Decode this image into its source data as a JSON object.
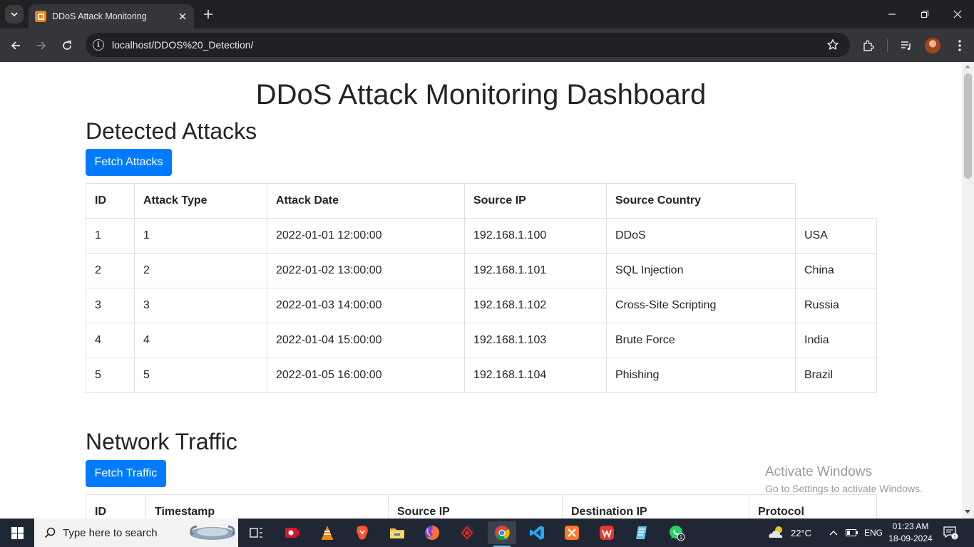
{
  "browser": {
    "tab_title": "DDoS Attack Monitoring",
    "url": "localhost/DDOS%20_Detection/"
  },
  "page": {
    "title": "DDoS Attack Monitoring Dashboard",
    "attacks": {
      "heading": "Detected Attacks",
      "button": "Fetch Attacks",
      "headers": [
        "ID",
        "Attack Type",
        "Attack Date",
        "Source IP",
        "Source Country"
      ],
      "rows": [
        [
          "1",
          "1",
          "2022-01-01 12:00:00",
          "192.168.1.100",
          "DDoS",
          "USA"
        ],
        [
          "2",
          "2",
          "2022-01-02 13:00:00",
          "192.168.1.101",
          "SQL Injection",
          "China"
        ],
        [
          "3",
          "3",
          "2022-01-03 14:00:00",
          "192.168.1.102",
          "Cross-Site Scripting",
          "Russia"
        ],
        [
          "4",
          "4",
          "2022-01-04 15:00:00",
          "192.168.1.103",
          "Brute Force",
          "India"
        ],
        [
          "5",
          "5",
          "2022-01-05 16:00:00",
          "192.168.1.104",
          "Phishing",
          "Brazil"
        ]
      ]
    },
    "traffic": {
      "heading": "Network Traffic",
      "button": "Fetch Traffic",
      "headers": [
        "ID",
        "Timestamp",
        "Source IP",
        "Destination IP",
        "Protocol"
      ]
    }
  },
  "watermark": {
    "line1": "Activate Windows",
    "line2": "Go to Settings to activate Windows."
  },
  "taskbar": {
    "search_placeholder": "Type here to search",
    "weather": "22°C",
    "language": "ENG",
    "time": "01:23 AM",
    "date": "18-09-2024",
    "whatsapp_badge": "1",
    "notification_badge": "1"
  },
  "colors": {
    "primary_button": "#007bff",
    "browser_frame": "#202124",
    "toolbar": "#35363a",
    "taskbar": "#1f2735"
  }
}
